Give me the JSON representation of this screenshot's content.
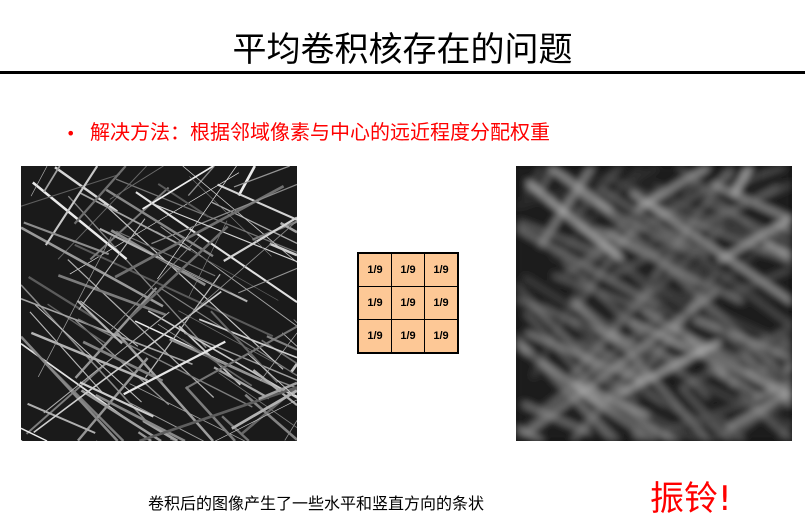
{
  "slide": {
    "title": "平均卷积核存在的问题",
    "bullet": {
      "marker": "•",
      "text": "解决方法：根据邻域像素与中心的远近程度分配权重"
    },
    "kernel": {
      "cells": [
        "1/9",
        "1/9",
        "1/9",
        "1/9",
        "1/9",
        "1/9",
        "1/9",
        "1/9",
        "1/9"
      ],
      "fill_color": "#fdc896"
    },
    "caption": "卷积后的图像产生了一些水平和竖直方向的条状",
    "ringing_label": "振铃!",
    "accent_color": "#ff0000"
  }
}
